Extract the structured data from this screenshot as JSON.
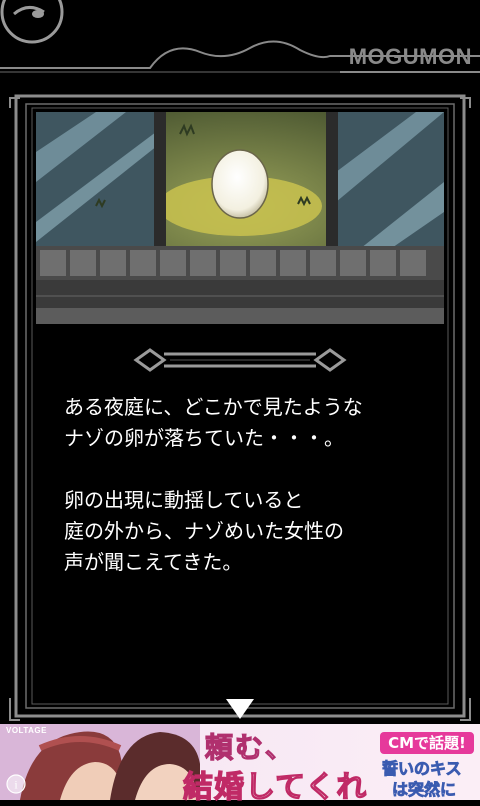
{
  "header": {
    "brand": "MOGUMON"
  },
  "story": {
    "paragraphs": [
      "ある夜庭に、どこかで見たような\nナゾの卵が落ちていた・・・。",
      "卵の出現に動揺していると\n庭の外から、ナゾめいた女性の\n声が聞こえてきた。"
    ]
  },
  "ad": {
    "brand": "VOLTAGE",
    "headline_1": "頼む、",
    "headline_2": "結婚してくれ",
    "badge": "CMで話題!",
    "subline_1": "誓いのキス",
    "subline_2": "は突然に"
  },
  "icons": {
    "next": "triangle-down-icon",
    "info": "info-icon",
    "logo": "creature-logo-icon"
  },
  "colors": {
    "background": "#000000",
    "frame": "#8c8c8c",
    "brand_text": "#8a8a8a",
    "ad_accent": "#e6399b"
  }
}
